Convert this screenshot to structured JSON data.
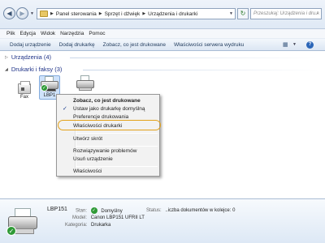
{
  "address_bar": {
    "breadcrumbs": [
      "Panel sterowania",
      "Sprzęt i dźwięk",
      "Urządzenia i drukarki"
    ],
    "search_placeholder": "Przeszukaj: Urządzenia i dru..."
  },
  "menu": [
    "Plik",
    "Edycja",
    "Widok",
    "Narzędzia",
    "Pomoc"
  ],
  "toolbar": {
    "commands": [
      "Dodaj urządzenie",
      "Dodaj drukarkę",
      "Zobacz, co jest drukowane",
      "Właściwości serwera wydruku"
    ],
    "help_label": "?"
  },
  "groups": {
    "devices": "Urządzenia (4)",
    "printers": "Drukarki i faksy (3)"
  },
  "devices": [
    {
      "label": "Fax",
      "icon": "fax-icon"
    },
    {
      "label": "LBP1",
      "icon": "printer-icon",
      "selected": true,
      "default": true
    },
    {
      "label": "",
      "icon": "printer-icon"
    }
  ],
  "context_menu": [
    {
      "label": "Zobacz, co jest drukowane",
      "bold": true
    },
    {
      "label": "Ustaw jako drukarkę domyślną",
      "checked": true
    },
    {
      "label": "Preferencje drukowania"
    },
    {
      "label": "Właściwości drukarki",
      "highlighted": true
    },
    {
      "label": "Utwórz skrót"
    },
    {
      "label": "Rozwiązywanie problemów"
    },
    {
      "label": "Usuń urządzenie"
    },
    {
      "label": "Właściwości"
    }
  ],
  "details": {
    "name": "LBP151",
    "state_label": "Stan:",
    "state_value": "Domyślny",
    "status_label": "Status:",
    "status_value": "..iczba dokumentów w kolejce: 0",
    "model_label": "Model:",
    "model_value": "Canon LBP151 UFRII LT",
    "category_label": "Kategoria:",
    "category_value": "Drukarka"
  },
  "colors": {
    "highlight_ring": "#e3a21a",
    "group_header": "#1e3287",
    "default_check": "#2f9a36"
  }
}
